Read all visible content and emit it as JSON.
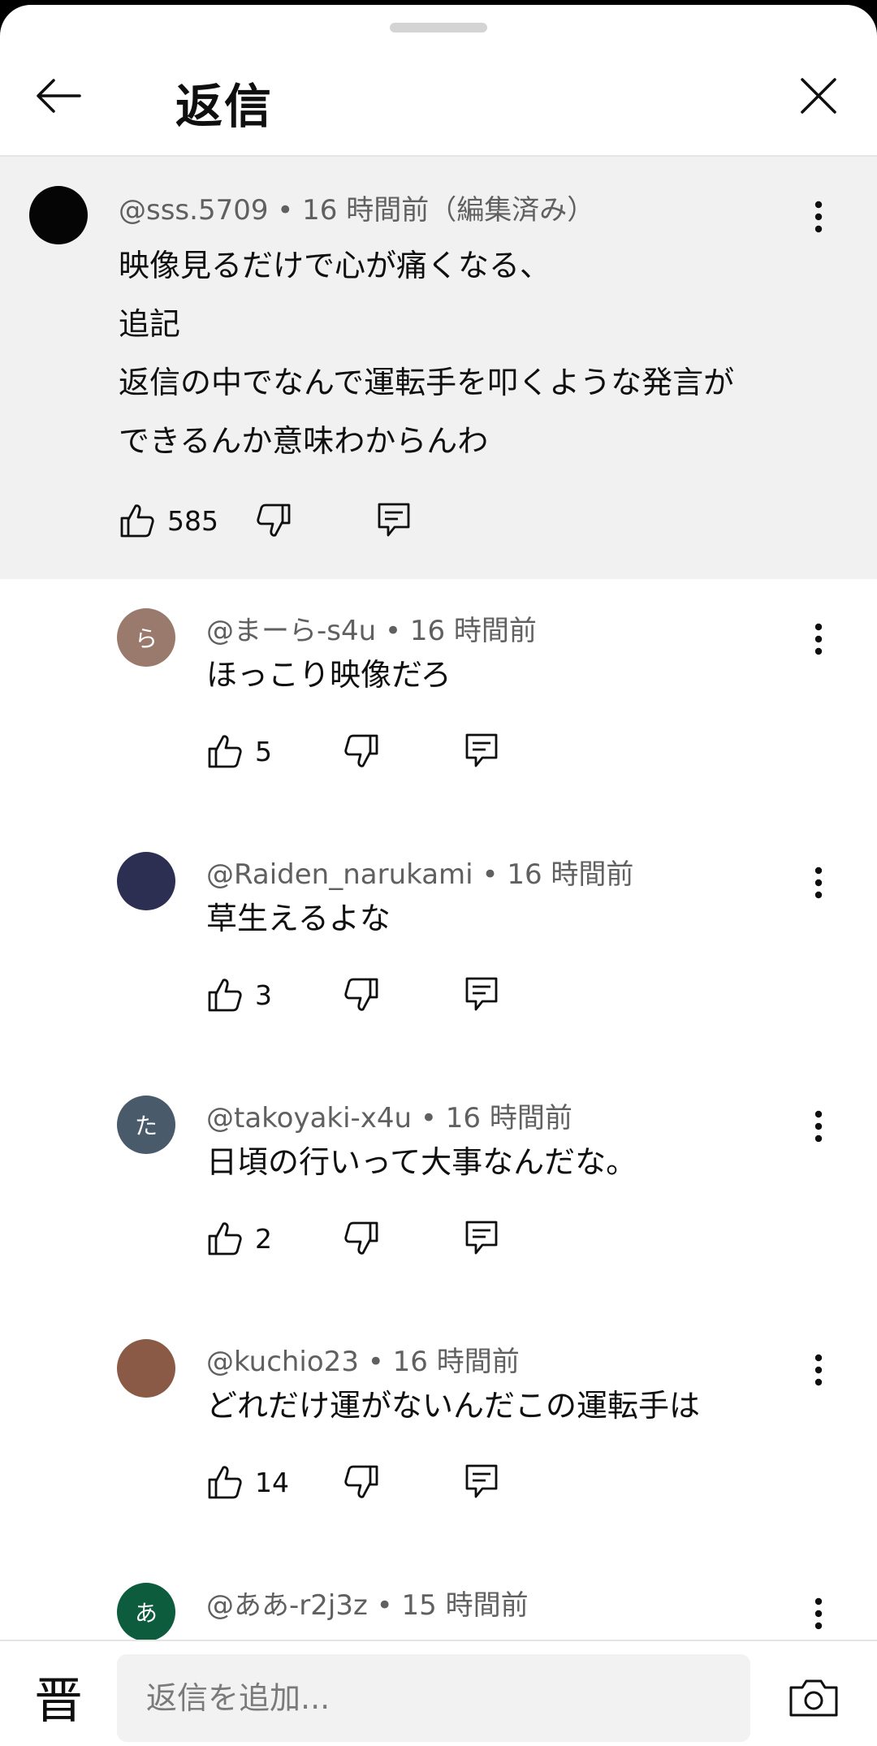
{
  "header": {
    "title": "返信"
  },
  "parent_comment": {
    "author": "@sss.5709",
    "time": "16 時間前",
    "edited": "（編集済み）",
    "lines": [
      "映像見るだけで心が痛くなる、",
      "追記",
      "返信の中でなんで運転手を叩くような発言が",
      "できるんか意味わからんわ"
    ],
    "likes": "585"
  },
  "replies": [
    {
      "author": "@まーら-s4u",
      "time": "16 時間前",
      "text": "ほっこり映像だろ",
      "likes": "5",
      "avatar_letter": "ら",
      "avatar_color": "#9a7a6d"
    },
    {
      "author": "@Raiden_narukami",
      "time": "16 時間前",
      "text": "草生えるよな",
      "likes": "3",
      "avatar_letter": "",
      "avatar_color": "#2c2f52"
    },
    {
      "author": "@takoyaki-x4u",
      "time": "16 時間前",
      "text": "日頃の行いって大事なんだな。",
      "likes": "2",
      "avatar_letter": "た",
      "avatar_color": "#495a6a"
    },
    {
      "author": "@kuchio23",
      "time": "16 時間前",
      "text": "どれだけ運がないんだこの運転手は",
      "likes": "14",
      "avatar_letter": "",
      "avatar_color": "#8a5a46"
    },
    {
      "author": "@ああ-r2j3z",
      "time": "15 時間前",
      "text": "",
      "likes": "",
      "avatar_letter": "あ",
      "avatar_color": "#0d5c3e"
    }
  ],
  "composer": {
    "ime_label": "晋",
    "placeholder": "返信を追加..."
  },
  "meta_separator": "•"
}
